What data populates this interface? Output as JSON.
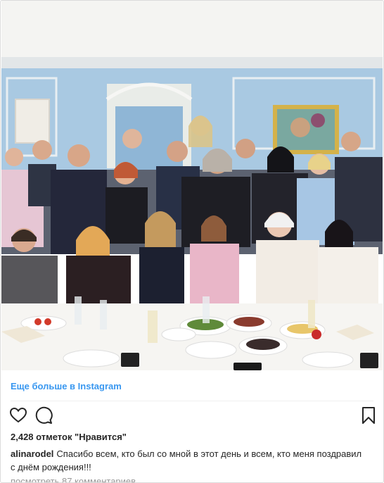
{
  "photo": {
    "alt_icon": "group-photo"
  },
  "links": {
    "view_more": "Еще больше в Instagram"
  },
  "actions": {
    "like_icon": "heart-icon",
    "comment_icon": "comment-icon",
    "save_icon": "bookmark-icon"
  },
  "post": {
    "likes_text": "2,428 отметок \"Нравится\"",
    "username": "alinarodel",
    "caption": "Спасибо всем, кто был со мной в этот день и всем, кто меня поздравил с днём рождения!!!",
    "comments_text": "посмотреть 87 комментариев"
  },
  "colors": {
    "link": "#3897f0",
    "wall": "#a9c9e2",
    "text": "#262626"
  }
}
